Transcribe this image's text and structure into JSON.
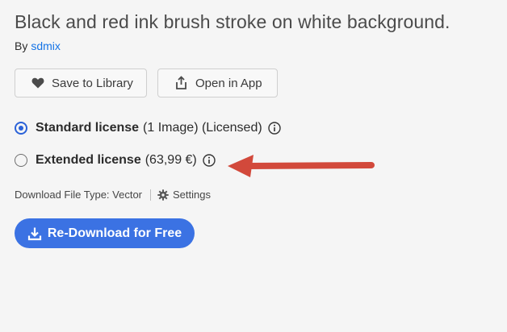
{
  "asset": {
    "title": "Black and red ink brush stroke on white background.",
    "by_label": "By",
    "author": "sdmix"
  },
  "actions": {
    "save_label": "Save to Library",
    "open_label": "Open in App"
  },
  "licenses": [
    {
      "name": "Standard license",
      "detail": "(1 Image) (Licensed)",
      "selected": true
    },
    {
      "name": "Extended license",
      "detail": "(63,99 €)",
      "selected": false
    }
  ],
  "download": {
    "file_type": "Download File Type: Vector",
    "settings_label": "Settings",
    "cta_label": "Re-Download for Free"
  },
  "colors": {
    "accent": "#3b72e3",
    "link": "#1473e6",
    "annotation_arrow": "#d2493b"
  },
  "icons": [
    "heart-icon",
    "share-icon",
    "info-icon",
    "gear-icon",
    "download-icon",
    "arrow-annotation"
  ]
}
